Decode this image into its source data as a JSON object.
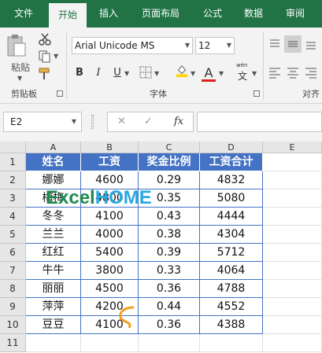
{
  "tabs": [
    "文件",
    "开始",
    "插入",
    "页面布局",
    "公式",
    "数据",
    "审阅"
  ],
  "ribbon": {
    "paste_label": "粘贴",
    "clipboard_label": "剪贴板",
    "font_label": "字体",
    "align_label": "对齐",
    "font_name": "Arial Unicode MS",
    "font_size": "12",
    "bold": "B",
    "italic": "I",
    "underline": "U",
    "phonetic": "wén",
    "phonetic_char": "文",
    "font_color_letter": "A",
    "accent": "#217346",
    "fill_color": "#ffd400",
    "font_color": "#e02020"
  },
  "formula_bar": {
    "name_box": "E2",
    "fx": "fx",
    "formula": ""
  },
  "sheet": {
    "columns": [
      "A",
      "B",
      "C",
      "D",
      "E"
    ],
    "rows": [
      "1",
      "2",
      "3",
      "4",
      "5",
      "6",
      "7",
      "8",
      "9",
      "10",
      "11"
    ],
    "header": [
      "姓名",
      "工资",
      "奖金比例",
      "工资合计"
    ],
    "data": [
      [
        "娜娜",
        "4600",
        "0.29",
        "4832"
      ],
      [
        "梅梅",
        "4800",
        "0.35",
        "5080"
      ],
      [
        "冬冬",
        "4100",
        "0.43",
        "4444"
      ],
      [
        "兰兰",
        "4000",
        "0.38",
        "4304"
      ],
      [
        "红红",
        "5400",
        "0.39",
        "5712"
      ],
      [
        "牛牛",
        "3800",
        "0.33",
        "4064"
      ],
      [
        "丽丽",
        "4500",
        "0.36",
        "4788"
      ],
      [
        "萍萍",
        "4200",
        "0.44",
        "4552"
      ],
      [
        "豆豆",
        "4100",
        "0.36",
        "4388"
      ]
    ],
    "header_color": "#4472c4"
  },
  "watermark": {
    "left": "Excel",
    "right": "HOME"
  }
}
